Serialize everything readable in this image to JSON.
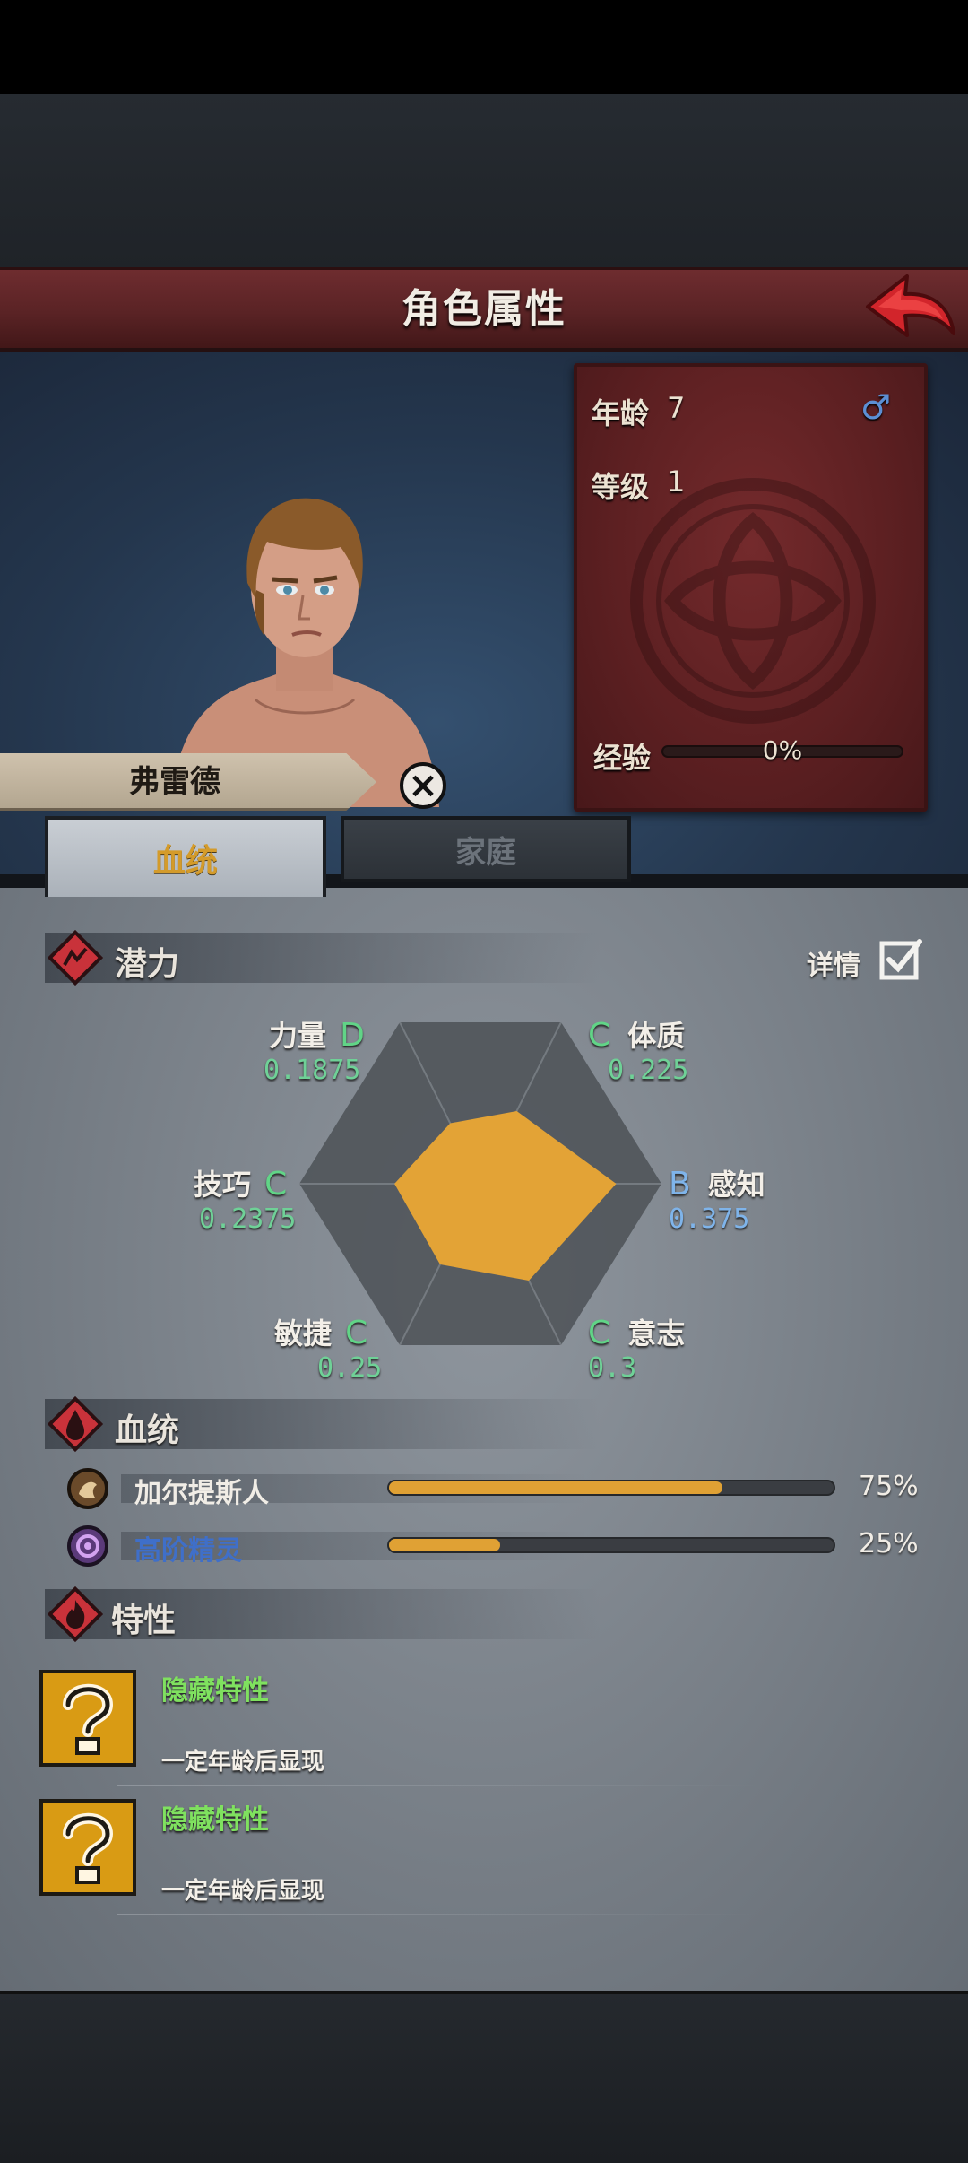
{
  "header": {
    "title": "角色属性"
  },
  "character": {
    "name": "弗雷德",
    "age_label": "年龄",
    "age": "7",
    "gender_symbol": "♂",
    "level_label": "等级",
    "level": "1",
    "exp_label": "经验",
    "exp_text": "0%",
    "exp_progress": 0
  },
  "tabs": [
    {
      "label": "血统",
      "active": true
    },
    {
      "label": "家庭",
      "active": false
    }
  ],
  "potential": {
    "title": "潜力",
    "detail_label": "详情",
    "detail_checked": true,
    "attributes": [
      {
        "name": "力量",
        "grade": "D",
        "value": "0.1875",
        "color": "green"
      },
      {
        "name": "体质",
        "grade": "C",
        "value": "0.225",
        "color": "green"
      },
      {
        "name": "感知",
        "grade": "B",
        "value": "0.375",
        "color": "blue"
      },
      {
        "name": "意志",
        "grade": "C",
        "value": "0.3",
        "color": "green"
      },
      {
        "name": "敏捷",
        "grade": "C",
        "value": "0.25",
        "color": "green"
      },
      {
        "name": "技巧",
        "grade": "C",
        "value": "0.2375",
        "color": "green"
      }
    ],
    "radar_fill_color": "#e3a336"
  },
  "bloodline": {
    "title": "血统",
    "items": [
      {
        "name": "加尔提斯人",
        "percent_text": "75%",
        "fraction": 0.75,
        "name_color": "#f1ede6"
      },
      {
        "name": "高阶精灵",
        "percent_text": "25%",
        "fraction": 0.25,
        "name_color": "#3f6fc9"
      }
    ]
  },
  "traits": {
    "title": "特性",
    "items": [
      {
        "title": "隐藏特性",
        "description": "一定年龄后显现"
      },
      {
        "title": "隐藏特性",
        "description": "一定年龄后显现"
      }
    ]
  },
  "colors": {
    "header_red": "#5a2325",
    "accent_orange": "#e0a134",
    "grade_green": "#61d487",
    "grade_blue": "#7fb4ea"
  }
}
